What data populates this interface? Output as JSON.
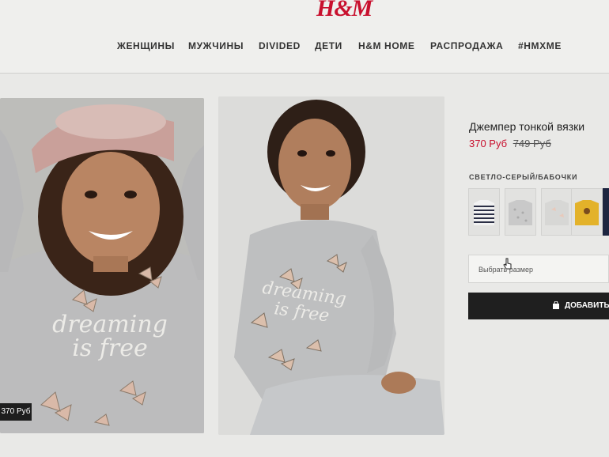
{
  "brand": {
    "logo_text": "H&M"
  },
  "nav": {
    "items": [
      {
        "label": "ЖЕНЩИНЫ"
      },
      {
        "label": "МУЖЧИНЫ"
      },
      {
        "label": "DIVIDED"
      },
      {
        "label": "ДЕТИ"
      },
      {
        "label": "H&M HOME"
      },
      {
        "label": "РАСПРОДАЖА"
      },
      {
        "label": "#HMXME"
      }
    ]
  },
  "gallery": {
    "photo_1_price_tag": "370 Руб",
    "print_text_line1": "dreaming",
    "print_text_line2": "is free"
  },
  "product": {
    "title": "Джемпер тонкой вязки",
    "price_sale": "370 Руб",
    "price_old": "749 Руб",
    "color_label": "СВЕТЛО-СЕРЫЙ/БАБОЧКИ",
    "swatches": [
      {
        "name": "striped-navy",
        "color": "#2b2f45"
      },
      {
        "name": "grey-pattern",
        "color": "#c9c9c9"
      },
      {
        "name": "light-grey-butterflies",
        "color": "#d7d7d5"
      },
      {
        "name": "yellow",
        "color": "#e3b22a"
      },
      {
        "name": "navy",
        "color": "#1d2540"
      }
    ],
    "size_placeholder": "Выбрать размер",
    "add_button_label": "ДОБАВИТЬ"
  },
  "colors": {
    "accent_red": "#c8102e",
    "button_black": "#1f1f1f"
  }
}
